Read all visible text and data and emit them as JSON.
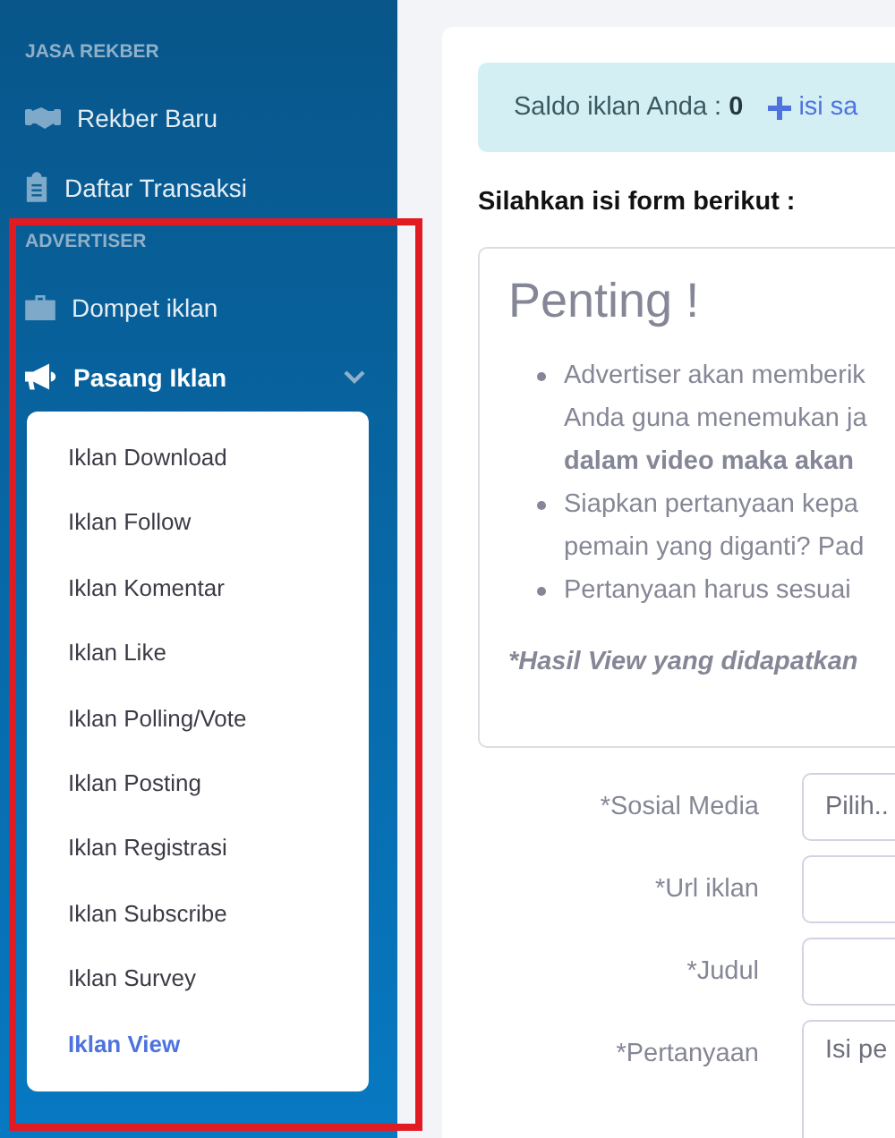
{
  "sidebar": {
    "sections": [
      {
        "heading": "JASA REKBER",
        "items": [
          {
            "label": "Rekber Baru",
            "selected": false
          },
          {
            "label": "Daftar Transaksi",
            "selected": false
          }
        ]
      },
      {
        "heading": "ADVERTISER",
        "items": [
          {
            "label": "Dompet iklan",
            "selected": false
          },
          {
            "label": "Pasang Iklan",
            "selected": true,
            "expanded": true,
            "children": [
              {
                "label": "Iklan Download",
                "selected": false
              },
              {
                "label": "Iklan Follow",
                "selected": false
              },
              {
                "label": "Iklan Komentar",
                "selected": false
              },
              {
                "label": "Iklan Like",
                "selected": false
              },
              {
                "label": "Iklan Polling/Vote",
                "selected": false
              },
              {
                "label": "Iklan Posting",
                "selected": false
              },
              {
                "label": "Iklan Registrasi",
                "selected": false
              },
              {
                "label": "Iklan Subscribe",
                "selected": false
              },
              {
                "label": "Iklan Survey",
                "selected": false
              },
              {
                "label": "Iklan View",
                "selected": true
              }
            ]
          }
        ]
      }
    ]
  },
  "balance_alert": {
    "label": "Saldo iklan Anda :",
    "value": "0",
    "link": "isi sa"
  },
  "form_heading": "Silahkan isi form berikut :",
  "notice": {
    "title": "Penting !",
    "bullets": [
      {
        "lines": [
          "Advertiser akan memberik",
          "Anda guna menemukan ja",
          "**dalam video maka akan**"
        ]
      },
      {
        "lines": [
          "Siapkan pertanyaan kepa",
          "pemain yang diganti? Pad"
        ]
      },
      {
        "lines": [
          "Pertanyaan harus sesuai"
        ]
      }
    ],
    "footnote": "*Hasil View yang didapatkan"
  },
  "form_fields": [
    {
      "label": "*Sosial Media",
      "kind": "select",
      "value": "Pilih.."
    },
    {
      "label": "*Url iklan",
      "kind": "text"
    },
    {
      "label": "*Judul",
      "kind": "text"
    },
    {
      "label": "*Pertanyaan",
      "kind": "textarea",
      "placeholder": "Isi pe"
    }
  ]
}
